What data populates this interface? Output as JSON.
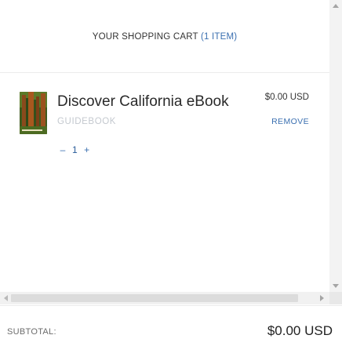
{
  "cart": {
    "title": "YOUR SHOPPING CART",
    "count_label": "(1 ITEM)",
    "items": [
      {
        "name": "Discover California eBook",
        "subtitle": "GUIDEBOOK",
        "price": "$0.00 USD",
        "remove_label": "REMOVE",
        "quantity": "1",
        "decrease_label": "–",
        "increase_label": "+",
        "thumbnail_icon": "redwood-forest-cover-image"
      }
    ]
  },
  "footer": {
    "subtotal_label": "SUBTOTAL:",
    "subtotal_value": "$0.00 USD"
  },
  "colors": {
    "accent": "#3a6fb0",
    "muted": "#c4c9cf",
    "text": "#2a2a2a"
  }
}
